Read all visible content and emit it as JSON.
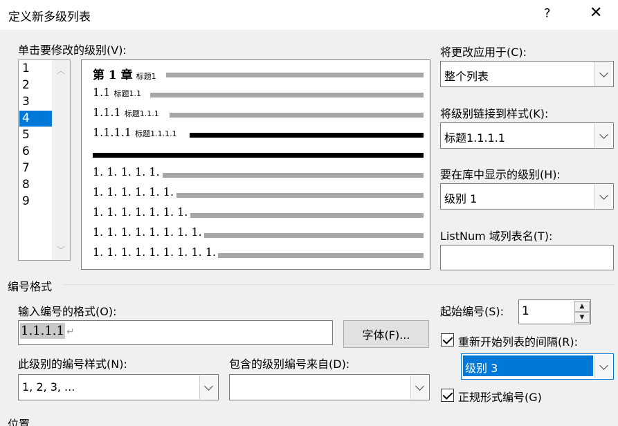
{
  "window": {
    "title": "定义新多级列表",
    "help_label": "?",
    "close_label": "✕"
  },
  "levels": {
    "label": "单击要修改的级别(V):",
    "items": [
      "1",
      "2",
      "3",
      "4",
      "5",
      "6",
      "7",
      "8",
      "9"
    ],
    "selected": "4"
  },
  "preview": {
    "rows": [
      {
        "num": "第 1 章",
        "style": "标题1"
      },
      {
        "num": "1.1",
        "style": "标题1.1"
      },
      {
        "num": "1.1.1",
        "style": "标题1.1.1"
      },
      {
        "num": "1.1.1.1",
        "style": "标题1.1.1.1"
      },
      {
        "num": "1. 1. 1. 1. 1.",
        "style": ""
      },
      {
        "num": "1. 1. 1. 1. 1. 1.",
        "style": ""
      },
      {
        "num": "1. 1. 1. 1. 1. 1. 1.",
        "style": ""
      },
      {
        "num": "1. 1. 1. 1. 1. 1. 1. 1.",
        "style": ""
      },
      {
        "num": "1. 1. 1. 1. 1. 1. 1. 1. 1.",
        "style": ""
      }
    ]
  },
  "apply_to": {
    "label": "将更改应用于(C):",
    "value": "整个列表"
  },
  "link_style": {
    "label": "将级别链接到样式(K):",
    "value": "标题1.1.1.1"
  },
  "gallery_level": {
    "label": "要在库中显示的级别(H):",
    "value": "级别 1"
  },
  "listnum": {
    "label": "ListNum 域列表名(T):",
    "value": ""
  },
  "number_format": {
    "section": "编号格式",
    "format_label": "输入编号的格式(O):",
    "format_value": "1.1.1.1",
    "format_mark": "↵",
    "font_button": "字体(F)...",
    "style_label": "此级别的编号样式(N):",
    "style_value": "1, 2, 3, ...",
    "include_label": "包含的级别编号来自(D):",
    "include_value": ""
  },
  "start_at": {
    "label": "起始编号(S):",
    "value": "1"
  },
  "restart": {
    "label": "重新开始列表的间隔(R):",
    "checked": true,
    "value": "级别 3"
  },
  "legal": {
    "label": "正规形式编号(G)",
    "checked": true
  },
  "position": {
    "section": "位置"
  }
}
